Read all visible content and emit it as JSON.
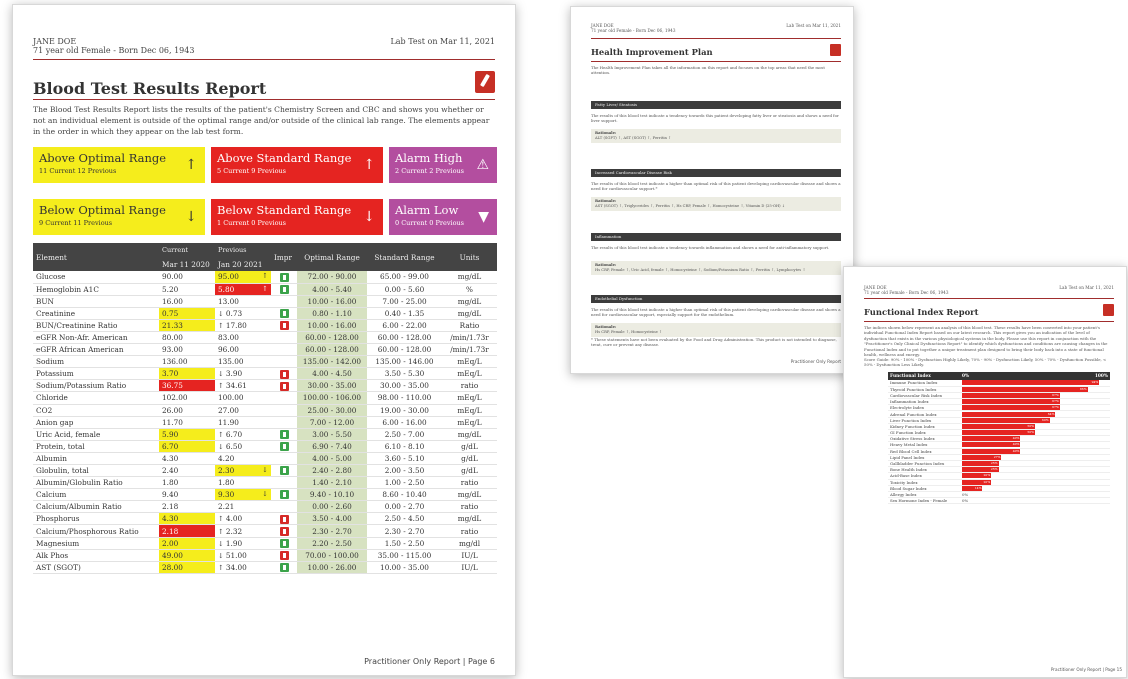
{
  "page1": {
    "patient_name": "JANE DOE",
    "patient_info": "71 year old Female - Born Dec 06, 1943",
    "lab_date": "Lab Test on Mar 11, 2021",
    "title": "Blood Test Results Report",
    "intro": "The Blood Test Results Report lists the results of the patient's Chemistry Screen and CBC and shows you whether or not an individual element is outside of the optimal range and/or outside of the clinical lab range. The elements appear in the order in which they appear on the lab test form.",
    "boxes": [
      {
        "label": "Above Optimal Range",
        "counts": "11 Current   12 Previous",
        "symbol": "↑",
        "color": "yellow"
      },
      {
        "label": "Above Standard Range",
        "counts": "5 Current   9 Previous",
        "symbol": "↑",
        "color": "red"
      },
      {
        "label": "Alarm High",
        "counts": "2 Current   2 Previous",
        "symbol": "⚠",
        "color": "purple"
      },
      {
        "label": "Below Optimal Range",
        "counts": "9 Current   11 Previous",
        "symbol": "↓",
        "color": "yellow"
      },
      {
        "label": "Below Standard Range",
        "counts": "1 Current   0 Previous",
        "symbol": "↓",
        "color": "red"
      },
      {
        "label": "Alarm Low",
        "counts": "0 Current   0 Previous",
        "symbol": "▼",
        "color": "purple"
      }
    ],
    "table_headers": {
      "element": "Element",
      "current_top": "Current",
      "current_date": "Mar 11 2020",
      "previous_top": "Previous",
      "previous_date": "Jan 20 2021",
      "impr": "Impr",
      "optimal": "Optimal Range",
      "standard": "Standard Range",
      "units": "Units"
    },
    "rows": [
      {
        "el": "Glucose",
        "cur": "90.00",
        "curc": "",
        "prev": "95.00",
        "prevc": "hy",
        "arrow": "↑",
        "imp": "g",
        "opt": "72.00 - 90.00",
        "std": "65.00 - 99.00",
        "unit": "mg/dL"
      },
      {
        "el": "Hemoglobin A1C",
        "cur": "5.20",
        "curc": "",
        "prev": "5.80",
        "prevc": "hr",
        "arrow": "↑",
        "imp": "g",
        "opt": "4.00 - 5.40",
        "std": "0.00 - 5.60",
        "unit": "%"
      },
      {
        "el": "BUN",
        "cur": "16.00",
        "curc": "",
        "prev": "13.00",
        "prevc": "",
        "arrow": "",
        "imp": "",
        "opt": "10.00 - 16.00",
        "std": "7.00 - 25.00",
        "unit": "mg/dL"
      },
      {
        "el": "Creatinine",
        "cur": "0.75",
        "curc": "hy",
        "prev": "0.73",
        "prevc": "",
        "arrow": "↓",
        "imp": "g",
        "opt": "0.80 - 1.10",
        "std": "0.40 - 1.35",
        "unit": "mg/dL"
      },
      {
        "el": "BUN/Creatinine Ratio",
        "cur": "21.33",
        "curc": "hy",
        "prev": "17.80",
        "prevc": "",
        "arrow": "↑",
        "imp": "r",
        "opt": "10.00 - 16.00",
        "std": "6.00 - 22.00",
        "unit": "Ratio"
      },
      {
        "el": "eGFR Non-Afr. American",
        "cur": "80.00",
        "curc": "",
        "prev": "83.00",
        "prevc": "",
        "arrow": "",
        "imp": "",
        "opt": "60.00 - 128.00",
        "std": "60.00 - 128.00",
        "unit": "/min/1.73r"
      },
      {
        "el": "eGFR African American",
        "cur": "93.00",
        "curc": "",
        "prev": "96.00",
        "prevc": "",
        "arrow": "",
        "imp": "",
        "opt": "60.00 - 128.00",
        "std": "60.00 - 128.00",
        "unit": "/min/1.73r"
      },
      {
        "el": "Sodium",
        "cur": "136.00",
        "curc": "",
        "prev": "135.00",
        "prevc": "",
        "arrow": "",
        "imp": "",
        "opt": "135.00 - 142.00",
        "std": "135.00 - 146.00",
        "unit": "mEq/L"
      },
      {
        "el": "Potassium",
        "cur": "3.70",
        "curc": "hy",
        "prev": "3.90",
        "prevc": "",
        "arrow": "↓",
        "imp": "r",
        "opt": "4.00 - 4.50",
        "std": "3.50 - 5.30",
        "unit": "mEq/L"
      },
      {
        "el": "Sodium/Potassium Ratio",
        "cur": "36.75",
        "curc": "hr",
        "prev": "34.61",
        "prevc": "",
        "arrow": "↑",
        "imp": "r",
        "opt": "30.00 - 35.00",
        "std": "30.00 - 35.00",
        "unit": "ratio"
      },
      {
        "el": "Chloride",
        "cur": "102.00",
        "curc": "",
        "prev": "100.00",
        "prevc": "",
        "arrow": "",
        "imp": "",
        "opt": "100.00 - 106.00",
        "std": "98.00 - 110.00",
        "unit": "mEq/L"
      },
      {
        "el": "CO2",
        "cur": "26.00",
        "curc": "",
        "prev": "27.00",
        "prevc": "",
        "arrow": "",
        "imp": "",
        "opt": "25.00 - 30.00",
        "std": "19.00 - 30.00",
        "unit": "mEq/L"
      },
      {
        "el": "Anion gap",
        "cur": "11.70",
        "curc": "",
        "prev": "11.90",
        "prevc": "",
        "arrow": "",
        "imp": "",
        "opt": "7.00 - 12.00",
        "std": "6.00 - 16.00",
        "unit": "mEq/L"
      },
      {
        "el": "Uric Acid, female",
        "cur": "5.90",
        "curc": "hy",
        "prev": "6.70",
        "prevc": "",
        "arrow": "↑",
        "imp": "g",
        "opt": "3.00 - 5.50",
        "std": "2.50 - 7.00",
        "unit": "mg/dL"
      },
      {
        "el": "Protein, total",
        "cur": "6.70",
        "curc": "hy",
        "prev": "6.50",
        "prevc": "",
        "arrow": "↓",
        "imp": "g",
        "opt": "6.90 - 7.40",
        "std": "6.10 - 8.10",
        "unit": "g/dL"
      },
      {
        "el": "Albumin",
        "cur": "4.30",
        "curc": "",
        "prev": "4.20",
        "prevc": "",
        "arrow": "",
        "imp": "",
        "opt": "4.00 - 5.00",
        "std": "3.60 - 5.10",
        "unit": "g/dL"
      },
      {
        "el": "Globulin, total",
        "cur": "2.40",
        "curc": "",
        "prev": "2.30",
        "prevc": "hy",
        "arrow": "↓",
        "imp": "g",
        "opt": "2.40 - 2.80",
        "std": "2.00 - 3.50",
        "unit": "g/dL"
      },
      {
        "el": "Albumin/Globulin Ratio",
        "cur": "1.80",
        "curc": "",
        "prev": "1.80",
        "prevc": "",
        "arrow": "",
        "imp": "",
        "opt": "1.40 - 2.10",
        "std": "1.00 - 2.50",
        "unit": "ratio"
      },
      {
        "el": "Calcium",
        "cur": "9.40",
        "curc": "",
        "prev": "9.30",
        "prevc": "hy",
        "arrow": "↓",
        "imp": "g",
        "opt": "9.40 - 10.10",
        "std": "8.60 - 10.40",
        "unit": "mg/dL"
      },
      {
        "el": "Calcium/Albumin Ratio",
        "cur": "2.18",
        "curc": "",
        "prev": "2.21",
        "prevc": "",
        "arrow": "",
        "imp": "",
        "opt": "0.00 - 2.60",
        "std": "0.00 - 2.70",
        "unit": "ratio"
      },
      {
        "el": "Phosphorus",
        "cur": "4.30",
        "curc": "hy",
        "prev": "4.00",
        "prevc": "",
        "arrow": "↑",
        "imp": "r",
        "opt": "3.50 - 4.00",
        "std": "2.50 - 4.50",
        "unit": "mg/dL"
      },
      {
        "el": "Calcium/Phosphorous Ratio",
        "cur": "2.18",
        "curc": "hr",
        "prev": "2.32",
        "prevc": "",
        "arrow": "↑",
        "imp": "r",
        "opt": "2.30 - 2.70",
        "std": "2.30 - 2.70",
        "unit": "ratio"
      },
      {
        "el": "Magnesium",
        "cur": "2.00",
        "curc": "hy",
        "prev": "1.90",
        "prevc": "",
        "arrow": "↓",
        "imp": "g",
        "opt": "2.20 - 2.50",
        "std": "1.50 - 2.50",
        "unit": "mg/dl"
      },
      {
        "el": "Alk Phos",
        "cur": "49.00",
        "curc": "hy",
        "prev": "51.00",
        "prevc": "",
        "arrow": "↓",
        "imp": "r",
        "opt": "70.00 - 100.00",
        "std": "35.00 - 115.00",
        "unit": "IU/L"
      },
      {
        "el": "AST (SGOT)",
        "cur": "28.00",
        "curc": "hy",
        "prev": "34.00",
        "prevc": "",
        "arrow": "↑",
        "imp": "g",
        "opt": "10.00 - 26.00",
        "std": "10.00 - 35.00",
        "unit": "IU/L"
      }
    ],
    "footer": "Practitioner Only Report | Page 6"
  },
  "page2": {
    "patient_name": "JANE DOE",
    "patient_info": "71 year old Female - Born Dec 06, 1943",
    "lab_date": "Lab Test on Mar 11, 2021",
    "title": "Health Improvement Plan",
    "intro": "The Health Improvement Plan takes all the information on this report and focuses on the top areas that need the most attention.",
    "sections": [
      {
        "heading": "Fatty Liver/ Steatosis",
        "text": "The results of this blood test indicate a tendency towards this patient developing fatty liver or steatosis and shows a need for liver support.",
        "rationale_label": "Rationale:",
        "rationale": "ALT (SGPT) ↑, AST (SGOT) ↑, Ferritin ↑"
      },
      {
        "heading": "Increased Cardiovascular Disease Risk",
        "text": "The results of this blood test indicate a higher than optimal risk of this patient developing cardiovascular disease and shows a need for cardiovascular support.*",
        "rationale_label": "Rationale:",
        "rationale": "AST (SGOT) ↑, Triglycerides ↑, Ferritin ↑, Hs CRP, Female ↑, Homocysteine ↑, Vitamin D (25-OH) ↓"
      },
      {
        "heading": "Inflammation",
        "text": "The results of this blood test indicate a tendency towards inflammation and shows a need for anti-inflammatory support.",
        "rationale_label": "Rationale:",
        "rationale": "Hs CRP, Female ↑, Uric Acid, female ↑, Homocysteine ↑, Sodium/Potassium Ratio ↑, Ferritin ↑, Lymphocytes ↑"
      },
      {
        "heading": "Endothelial Dysfunction",
        "text": "The results of this blood test indicate a higher than optimal risk of this patient developing cardiovascular disease and shows a need for cardiovascular support, especially support for the endothelium.",
        "rationale_label": "Rationale:",
        "rationale": "Hs CRP, Female ↑, Homocysteine ↑"
      }
    ],
    "disclaimer": "* These statements have not been evaluated by the Food and Drug Administration. This product is not intended to diagnose, treat, cure or prevent any disease.",
    "footer": "Practitioner Only Report"
  },
  "page3": {
    "patient_name": "JANE DOE",
    "patient_info": "71 year old Female - Born Dec 06, 1943",
    "lab_date": "Lab Test on Mar 11, 2021",
    "title": "Functional Index Report",
    "intro": "The indices shown below represent an analysis of this blood test. These results have been converted into your patient's individual Functional Index Report based on our latest research. This report gives you an indication of the level of dysfunction that exists in the various physiological systems in the body. Please use this report in conjunction with the \"Practitioner's Only Clinical Dysfunctions Report\" to identify which dysfunctions and conditions are causing changes in the Functional Index and to put together a unique treatment plan designed to bring their body back into a state of functional health, wellness and energy.",
    "score_guide": "Score Guide:  90% - 100% - Dysfunction Highly Likely,  70% - 90% - Dysfunction Likely,  50% - 70% - Dysfunction Possible,  < 50% - Dysfunction Less Likely.",
    "table_header": {
      "index": "Functional Index",
      "min": "0%",
      "max": "100%"
    },
    "indices": [
      {
        "name": "Immune Function Index",
        "value": 94
      },
      {
        "name": "Thyroid Function Index",
        "value": 86
      },
      {
        "name": "Cardiovascular Risk Index",
        "value": 67
      },
      {
        "name": "Inflammation Index",
        "value": 67
      },
      {
        "name": "Electrolyte Index",
        "value": 67
      },
      {
        "name": "Adrenal Function Index",
        "value": 64
      },
      {
        "name": "Liver Function Index",
        "value": 60
      },
      {
        "name": "Kidney Function Index",
        "value": 50
      },
      {
        "name": "GI Function Index",
        "value": 50
      },
      {
        "name": "Oxidative Stress Index",
        "value": 40
      },
      {
        "name": "Heavy Metal Index",
        "value": 40
      },
      {
        "name": "Red Blood Cell Index",
        "value": 40
      },
      {
        "name": "Lipid Panel Index",
        "value": 27
      },
      {
        "name": "Gallbladder Function Index",
        "value": 25
      },
      {
        "name": "Bone Health Index",
        "value": 25
      },
      {
        "name": "Acid-Base Index",
        "value": 20
      },
      {
        "name": "Toxicity Index",
        "value": 20
      },
      {
        "name": "Blood Sugar Index",
        "value": 14
      },
      {
        "name": "Allergy Index",
        "value": 0
      },
      {
        "name": "Sex Hormone Index - Female",
        "value": 0
      }
    ],
    "footer": "Practitioner Only Report | Page 15"
  },
  "colors": {
    "yellow": "#f5ed1c",
    "red": "#e52421",
    "purple": "#b34e9f",
    "green": "#3ba34a",
    "optimal_bg": "#d7e2c1",
    "header": "#444444"
  }
}
